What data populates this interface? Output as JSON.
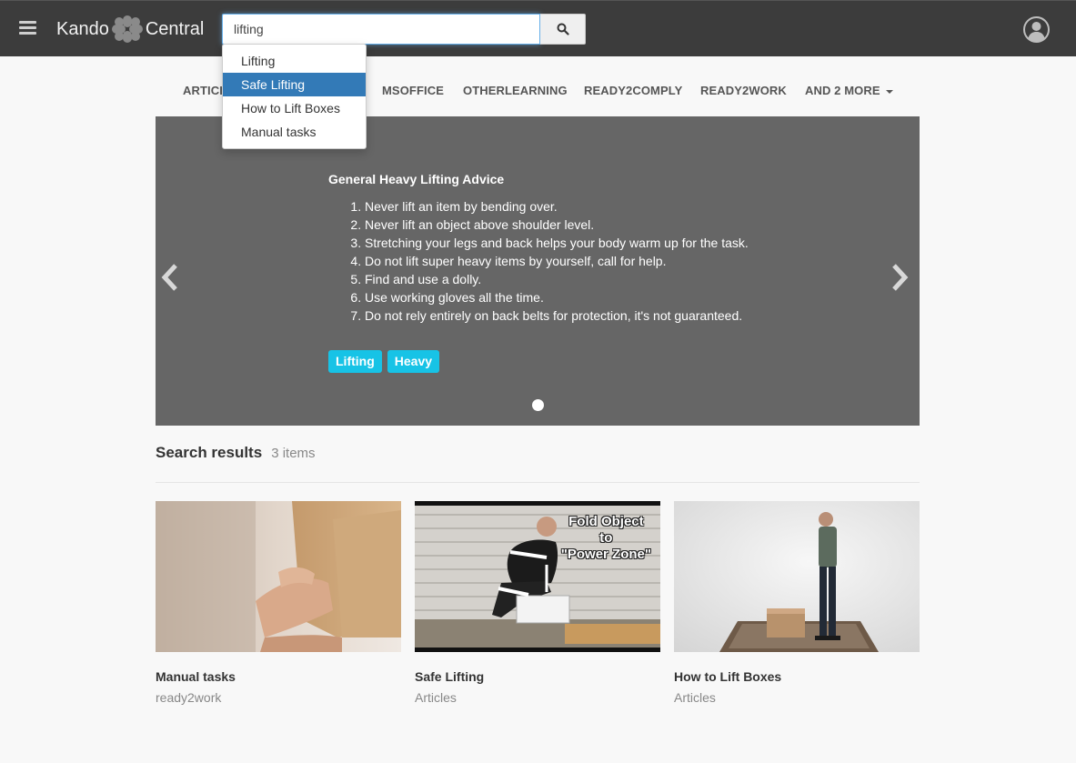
{
  "header": {
    "brand_left": "Kando",
    "brand_right": "Central",
    "search_value": "lifting"
  },
  "autocomplete": [
    {
      "label": "Lifting",
      "active": false
    },
    {
      "label": "Safe Lifting",
      "active": true
    },
    {
      "label": "How to Lift Boxes",
      "active": false
    },
    {
      "label": "Manual tasks",
      "active": false
    }
  ],
  "categories": {
    "articles": "ARTICLES",
    "msoffice": "MSOFFICE",
    "otherlearning": "OTHERLEARNING",
    "ready2comply": "READY2COMPLY",
    "ready2work": "READY2WORK",
    "more": "AND 2 MORE"
  },
  "carousel": {
    "title": "General Heavy Lifting Advice",
    "items": [
      "Never lift an item by bending over.",
      "Never lift an object above shoulder level.",
      "Stretching your legs and back helps your body warm up for the task.",
      "Do not lift super heavy items by yourself, call for help.",
      "Find and use a dolly.",
      "Use working gloves all the time.",
      "Do not rely entirely on back belts for protection, it's not guaranteed."
    ],
    "tags": [
      "Lifting",
      "Heavy"
    ],
    "background_color": "#666666",
    "tag_color": "#17c3e6"
  },
  "results": {
    "title": "Search results",
    "count": "3 items",
    "cards": [
      {
        "title": "Manual tasks",
        "subtitle": "ready2work"
      },
      {
        "title": "Safe Lifting",
        "subtitle": "Articles",
        "overlay": [
          "Fold Object",
          "to",
          "\"Power Zone\""
        ]
      },
      {
        "title": "How to Lift Boxes",
        "subtitle": "Articles"
      }
    ]
  },
  "icons": {
    "menu": "hamburger-icon",
    "search": "search-icon",
    "user": "user-avatar-icon",
    "prev": "chevron-left-icon",
    "next": "chevron-right-icon"
  }
}
